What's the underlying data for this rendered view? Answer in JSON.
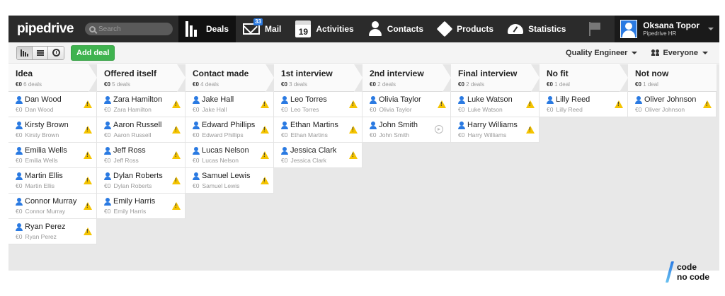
{
  "app": {
    "logo": "pipedrive"
  },
  "search": {
    "placeholder": "Search"
  },
  "nav": [
    {
      "label": "Deals",
      "icon": "pipeline-icon",
      "active": true
    },
    {
      "label": "Mail",
      "icon": "mail-icon",
      "badge": "33"
    },
    {
      "label": "Activities",
      "icon": "calendar-icon",
      "calendar_day": "19"
    },
    {
      "label": "Contacts",
      "icon": "person-icon"
    },
    {
      "label": "Products",
      "icon": "box-icon"
    },
    {
      "label": "Statistics",
      "icon": "gauge-icon"
    }
  ],
  "user": {
    "name": "Oksana Topor",
    "org": "Pipedrive HR"
  },
  "toolbar": {
    "add_deal": "Add deal",
    "pipeline_filter": "Quality Engineer",
    "owner_filter": "Everyone"
  },
  "stages": [
    {
      "name": "Idea",
      "value": "€0",
      "count": "6 deals",
      "deals": [
        {
          "title": "Dan Wood",
          "value": "€0",
          "person": "Dan Wood",
          "status": "warning"
        },
        {
          "title": "Kirsty Brown",
          "value": "€0",
          "person": "Kirsty Brown",
          "status": "warning"
        },
        {
          "title": "Emilia Wells",
          "value": "€0",
          "person": "Emilia Wells",
          "status": "warning"
        },
        {
          "title": "Martin Ellis",
          "value": "€0",
          "person": "Martin Ellis",
          "status": "warning"
        },
        {
          "title": "Connor Murray",
          "value": "€0",
          "person": "Connor Murray",
          "status": "warning"
        },
        {
          "title": "Ryan Perez",
          "value": "€0",
          "person": "Ryan Perez",
          "status": "warning"
        }
      ]
    },
    {
      "name": "Offered itself",
      "value": "€0",
      "count": "5 deals",
      "deals": [
        {
          "title": "Zara Hamilton",
          "value": "€0",
          "person": "Zara Hamilton",
          "status": "warning"
        },
        {
          "title": "Aaron Russell",
          "value": "€0",
          "person": "Aaron Russell",
          "status": "warning"
        },
        {
          "title": "Jeff Ross",
          "value": "€0",
          "person": "Jeff Ross",
          "status": "warning"
        },
        {
          "title": "Dylan Roberts",
          "value": "€0",
          "person": "Dylan Roberts",
          "status": "warning"
        },
        {
          "title": "Emily Harris",
          "value": "€0",
          "person": "Emily Harris",
          "status": "warning"
        }
      ]
    },
    {
      "name": "Contact made",
      "value": "€0",
      "count": "4 deals",
      "deals": [
        {
          "title": "Jake Hall",
          "value": "€0",
          "person": "Jake Hall",
          "status": "warning"
        },
        {
          "title": "Edward Phillips",
          "value": "€0",
          "person": "Edward Phillips",
          "status": "warning"
        },
        {
          "title": "Lucas Nelson",
          "value": "€0",
          "person": "Lucas Nelson",
          "status": "warning"
        },
        {
          "title": "Samuel Lewis",
          "value": "€0",
          "person": "Samuel Lewis",
          "status": "warning"
        }
      ]
    },
    {
      "name": "1st interview",
      "value": "€0",
      "count": "3 deals",
      "deals": [
        {
          "title": "Leo Torres",
          "value": "€0",
          "person": "Leo Torres",
          "status": "warning"
        },
        {
          "title": "Ethan Martins",
          "value": "€0",
          "person": "Ethan Martins",
          "status": "warning"
        },
        {
          "title": "Jessica Clark",
          "value": "€0",
          "person": "Jessica Clark",
          "status": "warning"
        }
      ]
    },
    {
      "name": "2nd interview",
      "value": "€0",
      "count": "2 deals",
      "deals": [
        {
          "title": "Olivia Taylor",
          "value": "€0",
          "person": "Olivia Taylor",
          "status": "warning"
        },
        {
          "title": "John Smith",
          "value": "€0",
          "person": "John Smith",
          "status": "next"
        }
      ]
    },
    {
      "name": "Final interview",
      "value": "€0",
      "count": "2 deals",
      "deals": [
        {
          "title": "Luke Watson",
          "value": "€0",
          "person": "Luke Watson",
          "status": "warning"
        },
        {
          "title": "Harry Williams",
          "value": "€0",
          "person": "Harry Williams",
          "status": "warning"
        }
      ]
    },
    {
      "name": "No fit",
      "value": "€0",
      "count": "1 deal",
      "deals": [
        {
          "title": "Lilly Reed",
          "value": "€0",
          "person": "Lilly Reed",
          "status": "warning"
        }
      ]
    },
    {
      "name": "Not now",
      "value": "€0",
      "count": "1 deal",
      "deals": [
        {
          "title": "Oliver Johnson",
          "value": "€0",
          "person": "Oliver Johnson",
          "status": "warning"
        }
      ]
    }
  ],
  "watermark": {
    "line1": "code",
    "line2": "no code"
  },
  "colors": {
    "topbar": "#2b2b2b",
    "accent_green": "#3fb34f",
    "person_blue": "#2a7ae2",
    "warning_yellow": "#f5c400"
  }
}
